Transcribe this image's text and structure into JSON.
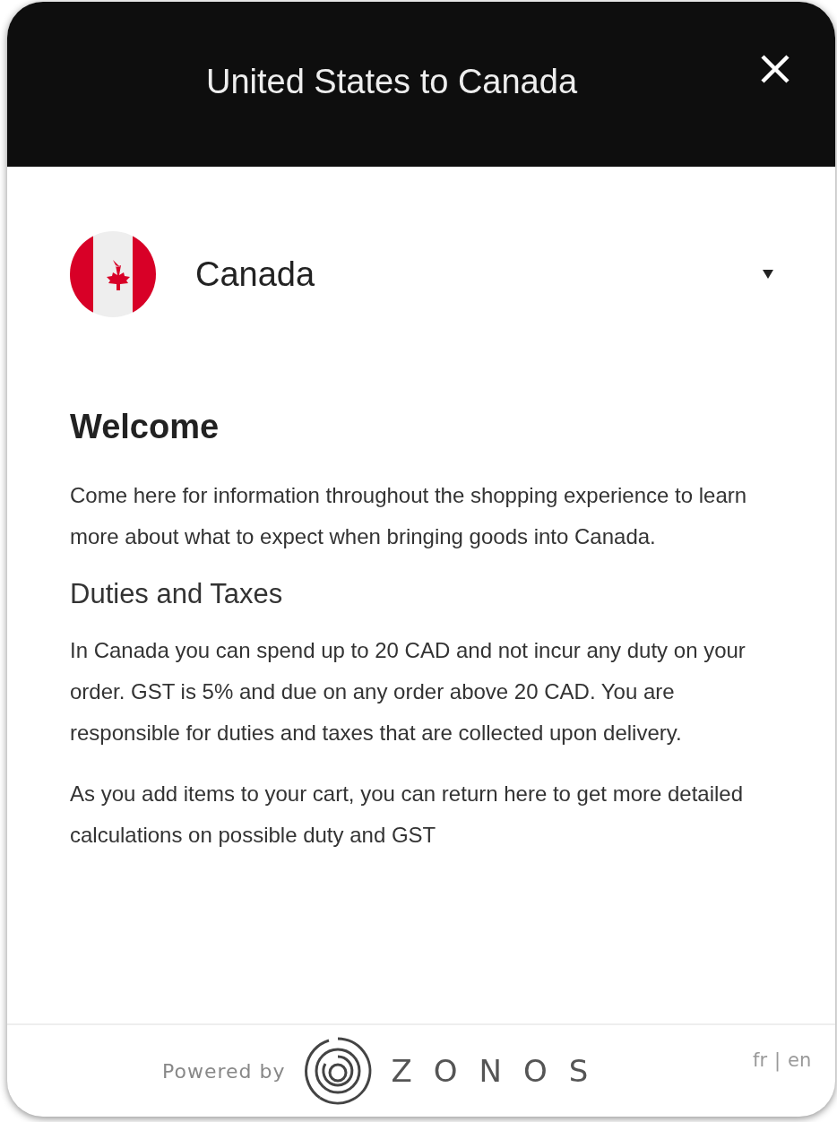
{
  "header": {
    "title": "United States to Canada"
  },
  "country_selector": {
    "country": "Canada"
  },
  "content": [
    {
      "kind": "heading",
      "text": "Welcome"
    },
    {
      "kind": "paragraph",
      "text": "Come here for information throughout the shopping experience to learn more about what to expect when bringing goods into Canada."
    },
    {
      "kind": "subheading",
      "text": "Duties and Taxes"
    },
    {
      "kind": "paragraph",
      "text": "In Canada you can spend up to 20 CAD and not incur any duty on your order. GST is 5% and due on any order above 20 CAD. You are responsible for duties and taxes that are collected upon delivery."
    },
    {
      "kind": "paragraph",
      "text": "As you add items to your cart, you can return here to get more detailed calculations on possible duty and GST"
    }
  ],
  "footer": {
    "powered_by": "Powered by",
    "brand": "ZONOS",
    "languages": [
      "fr",
      "en"
    ],
    "separator": "|"
  }
}
